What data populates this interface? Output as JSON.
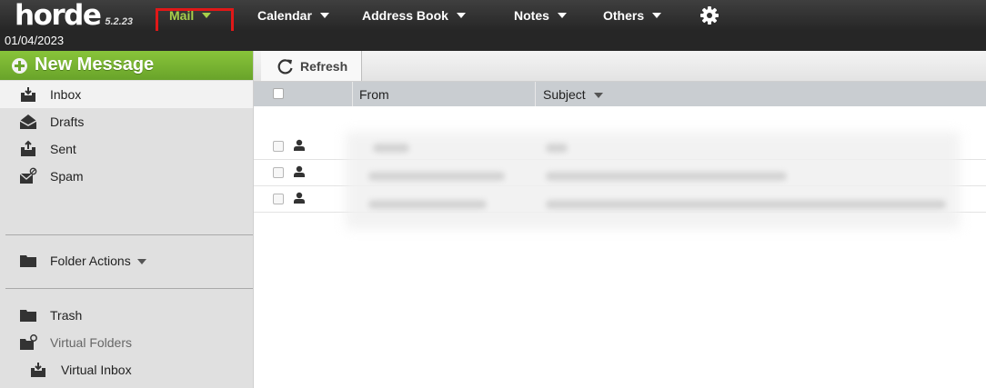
{
  "app": {
    "logo_text": "horde",
    "version": "5.2.23"
  },
  "nav": {
    "items": [
      {
        "label": "Mail",
        "icon": "caret-down-icon"
      },
      {
        "label": "Calendar",
        "icon": "caret-down-icon"
      },
      {
        "label": "Address Book",
        "icon": "caret-down-icon"
      },
      {
        "label": "Notes",
        "icon": "caret-down-icon"
      },
      {
        "label": "Others",
        "icon": "caret-down-icon"
      }
    ],
    "settings_icon": "gear-icon",
    "active": "Mail"
  },
  "date": "01/04/2023",
  "sidebar": {
    "new_message": "New Message",
    "folders": [
      {
        "label": "Inbox",
        "icon": "inbox-icon"
      },
      {
        "label": "Drafts",
        "icon": "drafts-icon"
      },
      {
        "label": "Sent",
        "icon": "sent-icon"
      },
      {
        "label": "Spam",
        "icon": "spam-icon"
      }
    ],
    "folder_actions": "Folder Actions",
    "extra": [
      {
        "label": "Trash",
        "icon": "trash-folder-icon"
      },
      {
        "label": "Virtual Folders",
        "icon": "virtual-folders-icon"
      },
      {
        "label": "Virtual Inbox",
        "icon": "inbox-icon"
      }
    ]
  },
  "toolbar": {
    "refresh": "Refresh"
  },
  "columns": {
    "from": "From",
    "subject": "Subject"
  },
  "colors": {
    "accent_green": "#7cb83a",
    "nav_active": "#a6cf4a",
    "highlight_border": "#e01818",
    "topbar": "#2c2c2c"
  }
}
